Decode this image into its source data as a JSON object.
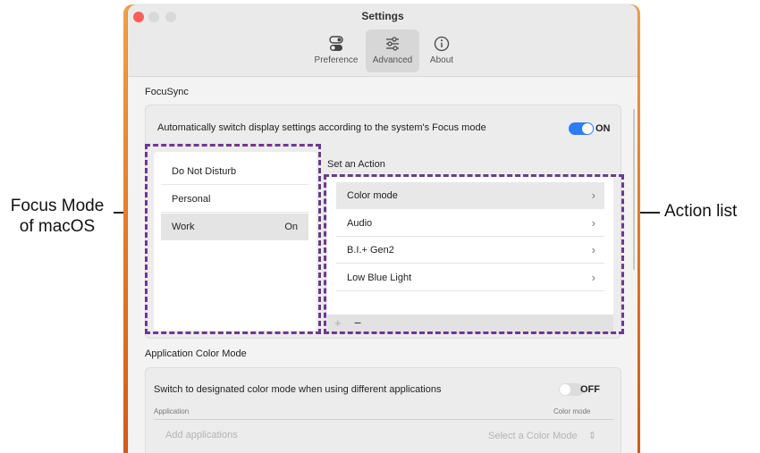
{
  "annotations": {
    "left_line1": "Focus Mode",
    "left_line2": "of macOS",
    "right": "Action list"
  },
  "window": {
    "title": "Settings"
  },
  "toolbar": {
    "items": [
      {
        "label": "Preference",
        "icon": "toggle-icon",
        "active": false
      },
      {
        "label": "Advanced",
        "icon": "sliders-icon",
        "active": true
      },
      {
        "label": "About",
        "icon": "info-icon",
        "active": false
      }
    ]
  },
  "focusync": {
    "title": "FocuSync",
    "auto_switch_text": "Automatically switch display settings according to the system's Focus mode",
    "toggle_label": "ON",
    "toggle_on": true,
    "accent": "#2f7bf6",
    "focus_modes": [
      {
        "name": "Do Not Disturb",
        "status": ""
      },
      {
        "name": "Personal",
        "status": ""
      },
      {
        "name": "Work",
        "status": "On"
      }
    ],
    "action_header": "Set an Action",
    "actions": [
      "Color mode",
      "Audio",
      "B.I.+ Gen2",
      "Low Blue Light"
    ],
    "add_symbol": "+",
    "remove_symbol": "−"
  },
  "app_color": {
    "title": "Application Color Mode",
    "switch_text": "Switch to designated color mode when using different applications",
    "toggle_label": "OFF",
    "toggle_on": false,
    "col_application": "Application",
    "col_color_mode": "Color mode",
    "add_placeholder": "Add applications",
    "select_placeholder": "Select a Color Mode"
  },
  "colors": {
    "dash": "#6b3a8e"
  }
}
